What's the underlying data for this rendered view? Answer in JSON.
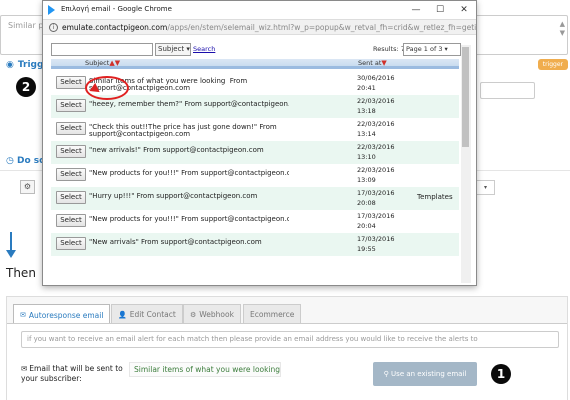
{
  "background": {
    "textarea_placeholder": "Similar pe",
    "trigger_title": "Trigg",
    "trigger_badge": "trigger",
    "doso_title": "Do so",
    "then_label": "Then"
  },
  "popup": {
    "window_title": "Επιλογή email - Google Chrome",
    "url_host": "emulate.contactpigeon.com",
    "url_path": "/apps/en/stem/selemail_wiz.html?w_p=popup&w_retval_fh=crid&w_retlez_fh=getifhas",
    "subject_filter": "Subject ▾",
    "search_link": "Search",
    "results": "Results: 71",
    "page_select": "Page 1 of 3 ▾",
    "col_subject": "Subject",
    "col_sent": "Sent at",
    "select_label": "Select",
    "rows": [
      {
        "subject": "Similar items of what you were looking",
        "from": "support@contactpigeon.com",
        "date": "30/06/2016",
        "time": "20:41",
        "extra": "",
        "two_line": true
      },
      {
        "subject": "\"heeey, remember them?\"",
        "from": "support@contactpigeon.com",
        "date": "22/03/2016",
        "time": "13:18",
        "extra": "",
        "two_line": false
      },
      {
        "subject": "\"Check this out!!The price has just gone down!\"",
        "from": "support@contactpigeon.com",
        "date": "22/03/2016",
        "time": "13:14",
        "extra": "",
        "two_line": true
      },
      {
        "subject": "\"new arrivals!\"",
        "from": "support@contactpigeon.com",
        "date": "22/03/2016",
        "time": "13:10",
        "extra": "",
        "two_line": false
      },
      {
        "subject": "\"New products for you!!!\"",
        "from": "support@contactpigeon.com",
        "date": "22/03/2016",
        "time": "13:09",
        "extra": "",
        "two_line": false
      },
      {
        "subject": "\"Hurry up!!!\"",
        "from": "support@contactpigeon.com",
        "date": "17/03/2016",
        "time": "20:08",
        "extra": "Templates",
        "two_line": false
      },
      {
        "subject": "\"New products for you!!!\"",
        "from": "support@contactpigeon.com",
        "date": "17/03/2016",
        "time": "20:04",
        "extra": "",
        "two_line": false
      },
      {
        "subject": "\"New arrivals\"",
        "from": "support@contactpigeon.com",
        "date": "17/03/2016",
        "time": "19:55",
        "extra": "",
        "two_line": false
      }
    ]
  },
  "tabs": [
    {
      "label": "Autoresponse email",
      "icon": "envelope-icon"
    },
    {
      "label": "Edit Contact",
      "icon": "user-icon"
    },
    {
      "label": "Webhook",
      "icon": "gears-icon"
    },
    {
      "label": "Ecommerce",
      "icon": ""
    }
  ],
  "form": {
    "alert_placeholder": "if you want to receive an email alert for each match then please provide an email address you would like to receive the alerts to",
    "email_label_line1": "Email that will be sent to",
    "email_label_line2": "your subscriber:",
    "subject_value": "Similar items of what you were looking",
    "use_existing": "Use an existing email"
  },
  "badges": {
    "one": "1",
    "two": "2"
  },
  "colors": {
    "accent": "#2a7bbf",
    "highlight": "#e02020",
    "row_alt": "#eaf7f1"
  }
}
